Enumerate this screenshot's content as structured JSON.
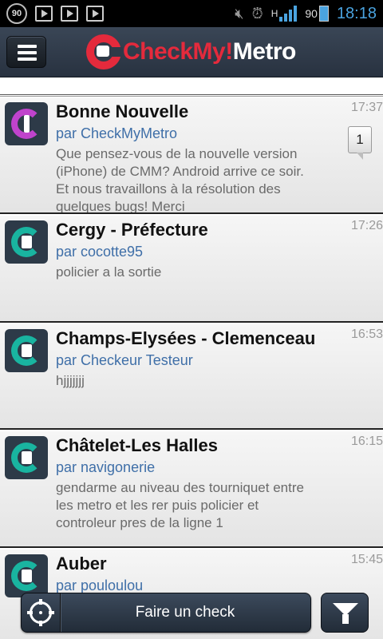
{
  "status_bar": {
    "badge": "90",
    "battery": "90",
    "time": "18:18",
    "network": "H",
    "icons": [
      "notification-badge-icon",
      "play-store-icon",
      "play-store-icon",
      "play-store-icon",
      "mute-icon",
      "alarm-icon",
      "signal-icon",
      "battery-icon"
    ]
  },
  "header": {
    "logo_red": "CheckMy!",
    "logo_white": "Metro",
    "menu_icon": "hamburger-menu-icon"
  },
  "items": [
    {
      "title": "Bonne Nouvelle",
      "author": "par CheckMyMetro",
      "message": "Que pensez-vous de la nouvelle version (iPhone) de CMM? Android arrive ce soir. Et nous travaillons à la résolution des quelques bugs! Merci",
      "time": "17:37",
      "comments": "1",
      "avatar_icon": "info-icon"
    },
    {
      "title": "Cergy - Préfecture",
      "author": "par cocotte95",
      "message": "policier a la sortie",
      "time": "17:26",
      "avatar_icon": "checkmymetro-icon"
    },
    {
      "title": "Champs-Elysées - Clemenceau",
      "author": "par Checkeur Testeur",
      "message": "hjjjjjjj",
      "time": "16:53",
      "avatar_icon": "checkmymetro-icon"
    },
    {
      "title": "Châtelet-Les Halles",
      "author": "par navigonerie",
      "message": "gendarme au niveau des tourniquet entre les metro et les rer puis policier et controleur pres de la ligne 1",
      "time": "16:15",
      "avatar_icon": "checkmymetro-icon"
    },
    {
      "title": "Auber",
      "author": "par pouloulou",
      "message": "",
      "time": "15:45",
      "avatar_icon": "checkmymetro-icon"
    }
  ],
  "bottom": {
    "check_label": "Faire un check",
    "check_icon": "crosshair-icon",
    "filter_icon": "filter-icon"
  }
}
